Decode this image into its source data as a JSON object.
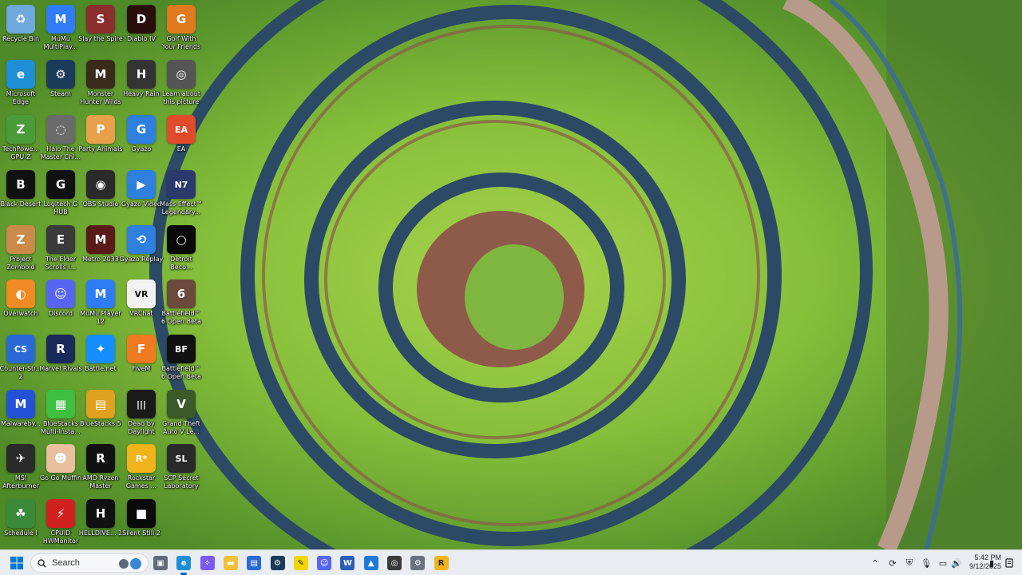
{
  "desktop": {
    "icons": [
      {
        "label": "Recycle Bin",
        "icon": "recycle-bin-icon",
        "color": "#6fa8dc",
        "glyph": "♻"
      },
      {
        "label": "MuMu MultiPlay...",
        "icon": "mumu-multiplayer-icon",
        "color": "#2f7cf6",
        "glyph": "M"
      },
      {
        "label": "Slay the Spire",
        "icon": "slay-the-spire-icon",
        "color": "#8b2e2e",
        "glyph": "S"
      },
      {
        "label": "Diablo IV",
        "icon": "diablo-iv-icon",
        "color": "#2a0d0d",
        "glyph": "D"
      },
      {
        "label": "Golf With Your Friends",
        "icon": "golf-with-friends-icon",
        "color": "#e07a1f",
        "glyph": "G"
      },
      {
        "label": "Microsoft Edge",
        "icon": "edge-icon",
        "color": "#1e8fd6",
        "glyph": "e"
      },
      {
        "label": "Steam",
        "icon": "steam-icon",
        "color": "#1b3b5a",
        "glyph": "⚙"
      },
      {
        "label": "Monster Hunter Wilds",
        "icon": "monster-hunter-icon",
        "color": "#3a2a1a",
        "glyph": "M"
      },
      {
        "label": "Heavy Rain",
        "icon": "heavy-rain-icon",
        "color": "#333333",
        "glyph": "H"
      },
      {
        "label": "Learn about this picture",
        "icon": "learn-picture-icon",
        "color": "#555555",
        "glyph": "◎"
      },
      {
        "label": "TechPowe... GPU-Z",
        "icon": "gpu-z-icon",
        "color": "#4a9c3a",
        "glyph": "Z"
      },
      {
        "label": "Halo The Master Chi...",
        "icon": "halo-icon",
        "color": "#6b6b6b",
        "glyph": "◌"
      },
      {
        "label": "Party Animals",
        "icon": "party-animals-icon",
        "color": "#e8a04a",
        "glyph": "P"
      },
      {
        "label": "Gyazo",
        "icon": "gyazo-icon",
        "color": "#2e7fe0",
        "glyph": "G"
      },
      {
        "label": "EA",
        "icon": "ea-icon",
        "color": "#e14a2a",
        "glyph": "EA"
      },
      {
        "label": "Black Desert",
        "icon": "black-desert-icon",
        "color": "#111111",
        "glyph": "B"
      },
      {
        "label": "Logitech G HUB",
        "icon": "logitech-ghub-icon",
        "color": "#111111",
        "glyph": "G"
      },
      {
        "label": "OBS Studio",
        "icon": "obs-studio-icon",
        "color": "#2a2a2a",
        "glyph": "◉"
      },
      {
        "label": "Gyazo Video",
        "icon": "gyazo-video-icon",
        "color": "#2e7fe0",
        "glyph": "▶"
      },
      {
        "label": "Mass Effect™ Legendary...",
        "icon": "mass-effect-icon",
        "color": "#2a3a6a",
        "glyph": "N7"
      },
      {
        "label": "Project Zomboid",
        "icon": "project-zomboid-icon",
        "color": "#c98a4a",
        "glyph": "Z"
      },
      {
        "label": "The Elder Scrolls I...",
        "icon": "elder-scrolls-icon",
        "color": "#3a3a3a",
        "glyph": "E"
      },
      {
        "label": "Metro 2033",
        "icon": "metro-2033-icon",
        "color": "#5a1a1a",
        "glyph": "M"
      },
      {
        "label": "Gyazo Replay",
        "icon": "gyazo-replay-icon",
        "color": "#2e7fe0",
        "glyph": "⟲"
      },
      {
        "label": "Detroit Beco...",
        "icon": "detroit-icon",
        "color": "#0a0a0a",
        "glyph": "○"
      },
      {
        "label": "Overwatch",
        "icon": "overwatch-icon",
        "color": "#f08a24",
        "glyph": "◐"
      },
      {
        "label": "Discord",
        "icon": "discord-icon",
        "color": "#5865f2",
        "glyph": "☺"
      },
      {
        "label": "MuMu Player 12",
        "icon": "mumu-player-icon",
        "color": "#2f7cf6",
        "glyph": "M"
      },
      {
        "label": "VRChat",
        "icon": "vrchat-icon",
        "color": "#f2f2f2",
        "glyph": "VR"
      },
      {
        "label": "Battlefield™ 6 Open Beta",
        "icon": "battlefield-6-icon",
        "color": "#6a4a3a",
        "glyph": "6"
      },
      {
        "label": "Counter-Str... 2",
        "icon": "counter-strike-icon",
        "color": "#2a6ad6",
        "glyph": "CS"
      },
      {
        "label": "Marvel Rivals",
        "icon": "marvel-rivals-icon",
        "color": "#1a2a5a",
        "glyph": "R"
      },
      {
        "label": "Battle.net",
        "icon": "battle-net-icon",
        "color": "#148eff",
        "glyph": "✦"
      },
      {
        "label": "FiveM",
        "icon": "fivem-icon",
        "color": "#f07a20",
        "glyph": "F"
      },
      {
        "label": "Battlefield™ 6 Open Beta",
        "icon": "battlefield-6-beta-icon",
        "color": "#111111",
        "glyph": "BF"
      },
      {
        "label": "Malwareby...",
        "icon": "malwarebytes-icon",
        "color": "#2452d6",
        "glyph": "M"
      },
      {
        "label": "BlueStacks Multi-Insta...",
        "icon": "bluestacks-multi-icon",
        "color": "#3fbf3f",
        "glyph": "▦"
      },
      {
        "label": "BlueStacks 5",
        "icon": "bluestacks-5-icon",
        "color": "#e0a020",
        "glyph": "▤"
      },
      {
        "label": "Dead by Daylight",
        "icon": "dead-by-daylight-icon",
        "color": "#1a1a1a",
        "glyph": "|||"
      },
      {
        "label": "Grand Theft Auto V Le...",
        "icon": "gta-v-icon",
        "color": "#3a5a2a",
        "glyph": "V"
      },
      {
        "label": "MSI Afterburner",
        "icon": "msi-afterburner-icon",
        "color": "#2a2a2a",
        "glyph": "✈"
      },
      {
        "label": "Go Go Muffin",
        "icon": "go-go-muffin-icon",
        "color": "#e8c0a0",
        "glyph": "☻"
      },
      {
        "label": "AMD Ryzen Master",
        "icon": "ryzen-master-icon",
        "color": "#111111",
        "glyph": "R"
      },
      {
        "label": "Rockstar Games ...",
        "icon": "rockstar-games-icon",
        "color": "#f0b41a",
        "glyph": "R*"
      },
      {
        "label": "SCP Secret Laboratory",
        "icon": "scp-lab-icon",
        "color": "#2a2a2a",
        "glyph": "SL"
      },
      {
        "label": "Schedule I",
        "icon": "schedule-i-icon",
        "color": "#3a8a3a",
        "glyph": "☘"
      },
      {
        "label": "CPUID HWMonitor",
        "icon": "hwmonitor-icon",
        "color": "#d02020",
        "glyph": "⚡"
      },
      {
        "label": "HELLDIVE... 2",
        "icon": "helldivers-icon",
        "color": "#111111",
        "glyph": "H"
      },
      {
        "label": "Silent Still 2",
        "icon": "silent-still-icon",
        "color": "#0a0a0a",
        "glyph": "■"
      }
    ]
  },
  "taskbar": {
    "search_placeholder": "Search",
    "apps": [
      {
        "name": "taskbar-task-view",
        "icon": "task-view-icon",
        "color": "#606a78",
        "glyph": "▣"
      },
      {
        "name": "taskbar-edge",
        "icon": "edge-icon",
        "color": "#1e8fd6",
        "glyph": "e",
        "active": true
      },
      {
        "name": "taskbar-copilot",
        "icon": "copilot-icon",
        "color": "#7a5af0",
        "glyph": "✧"
      },
      {
        "name": "taskbar-file-explorer",
        "icon": "folder-icon",
        "color": "#f2c037",
        "glyph": "▬"
      },
      {
        "name": "taskbar-store",
        "icon": "store-icon",
        "color": "#2a6ad6",
        "glyph": "▤"
      },
      {
        "name": "taskbar-steam",
        "icon": "steam-icon",
        "color": "#1b3b5a",
        "glyph": "⚙"
      },
      {
        "name": "taskbar-sticky-notes",
        "icon": "sticky-notes-icon",
        "color": "#f2d600",
        "glyph": "✎"
      },
      {
        "name": "taskbar-discord",
        "icon": "discord-icon",
        "color": "#5865f2",
        "glyph": "☺"
      },
      {
        "name": "taskbar-word",
        "icon": "word-icon",
        "color": "#2b5cb8",
        "glyph": "W"
      },
      {
        "name": "taskbar-photos",
        "icon": "photos-icon",
        "color": "#1e7ad6",
        "glyph": "▲"
      },
      {
        "name": "taskbar-capture",
        "icon": "capture-icon",
        "color": "#3a3a3a",
        "glyph": "◎"
      },
      {
        "name": "taskbar-settings",
        "icon": "settings-icon",
        "color": "#6a7280",
        "glyph": "⚙"
      },
      {
        "name": "taskbar-rockstar",
        "icon": "rockstar-games-icon",
        "color": "#f0b41a",
        "glyph": "R"
      }
    ],
    "tray": {
      "items": [
        {
          "name": "tray-overflow",
          "icon": "chevron-up-icon",
          "glyph": "⌃"
        },
        {
          "name": "tray-app-1",
          "icon": "sync-icon",
          "glyph": "⟳"
        },
        {
          "name": "tray-app-2",
          "icon": "shield-icon",
          "glyph": "⛨"
        },
        {
          "name": "tray-mic",
          "icon": "microphone-icon",
          "glyph": "🎙"
        },
        {
          "name": "tray-network",
          "icon": "network-icon",
          "glyph": "▭"
        },
        {
          "name": "tray-volume",
          "icon": "speaker-icon",
          "glyph": "🔊"
        },
        {
          "name": "tray-battery",
          "icon": "battery-icon",
          "glyph": "▮"
        }
      ],
      "time": "5:42 PM",
      "date": "9/12/2025",
      "notification_icon": "notification-bell-icon"
    }
  }
}
